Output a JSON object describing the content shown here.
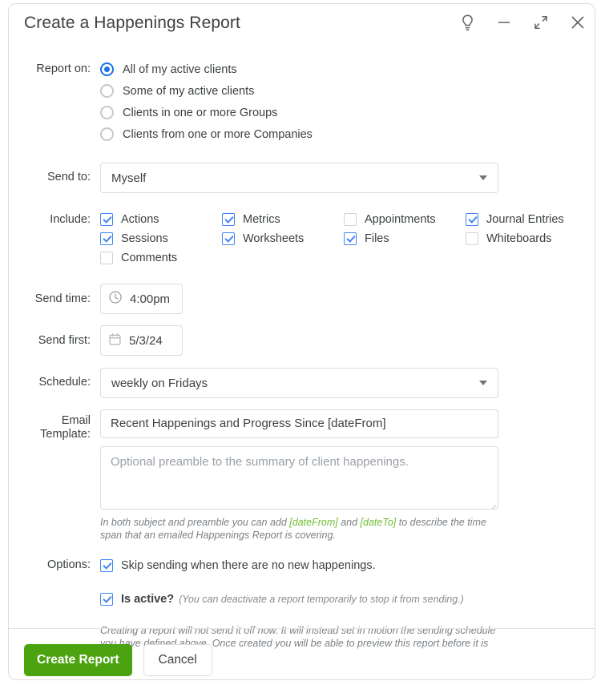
{
  "window": {
    "title": "Create a Happenings Report",
    "controls": [
      {
        "name": "help-idea-icon",
        "icon": "lightbulb"
      },
      {
        "name": "minimize-button",
        "icon": "minus"
      },
      {
        "name": "collapse-button",
        "icon": "collapse-arrows"
      },
      {
        "name": "close-button",
        "icon": "x"
      }
    ]
  },
  "colors": {
    "accent_blue": "#1a73e8",
    "checkbox_blue": "#4285f4",
    "primary_green": "#4ba310",
    "token_green": "#6fbe31",
    "border": "#dadce0",
    "text": "#3c4043",
    "muted": "#9aa0a6"
  },
  "report_on": {
    "label": "Report on:",
    "options": [
      {
        "label": "All of my active clients",
        "checked": true
      },
      {
        "label": "Some of my active clients",
        "checked": false
      },
      {
        "label": "Clients in one or more Groups",
        "checked": false
      },
      {
        "label": "Clients from one or more Companies",
        "checked": false
      }
    ]
  },
  "send_to": {
    "label": "Send to:",
    "value": "Myself"
  },
  "include": {
    "label": "Include:",
    "items": [
      {
        "label": "Actions",
        "checked": true
      },
      {
        "label": "Metrics",
        "checked": true
      },
      {
        "label": "Appointments",
        "checked": false
      },
      {
        "label": "Journal Entries",
        "checked": true
      },
      {
        "label": "Sessions",
        "checked": true
      },
      {
        "label": "Worksheets",
        "checked": true
      },
      {
        "label": "Files",
        "checked": true
      },
      {
        "label": "Whiteboards",
        "checked": false
      },
      {
        "label": "Comments",
        "checked": false
      }
    ]
  },
  "send_time": {
    "label": "Send time:",
    "value": "4:00pm",
    "icon": "clock-icon"
  },
  "send_first": {
    "label": "Send first:",
    "value": "5/3/24",
    "icon": "calendar-icon"
  },
  "schedule": {
    "label": "Schedule:",
    "value": "weekly on Fridays"
  },
  "email_template": {
    "label_line1": "Email",
    "label_line2": "Template:",
    "subject_value": "Recent Happenings and Progress Since [dateFrom]",
    "preamble_placeholder": "Optional preamble to the summary of client happenings.",
    "helper_prefix": "In both subject and preamble you can add ",
    "helper_token1": "[dateFrom]",
    "helper_mid": " and ",
    "helper_token2": "[dateTo]",
    "helper_suffix": " to describe the time span that an emailed Happenings Report is covering."
  },
  "options": {
    "label": "Options:",
    "skip_sending": {
      "label": "Skip sending when there are no new happenings.",
      "checked": true
    },
    "is_active": {
      "label": "Is active?",
      "note": "(You can deactivate a report temporarily to stop it from sending.)",
      "checked": true
    },
    "footnote": "Creating a report will not send it off now. It will instead set in motion the sending schedule you have defined above. Once created you will be able to preview this report before it is sent."
  },
  "footer": {
    "primary_label": "Create Report",
    "secondary_label": "Cancel"
  }
}
